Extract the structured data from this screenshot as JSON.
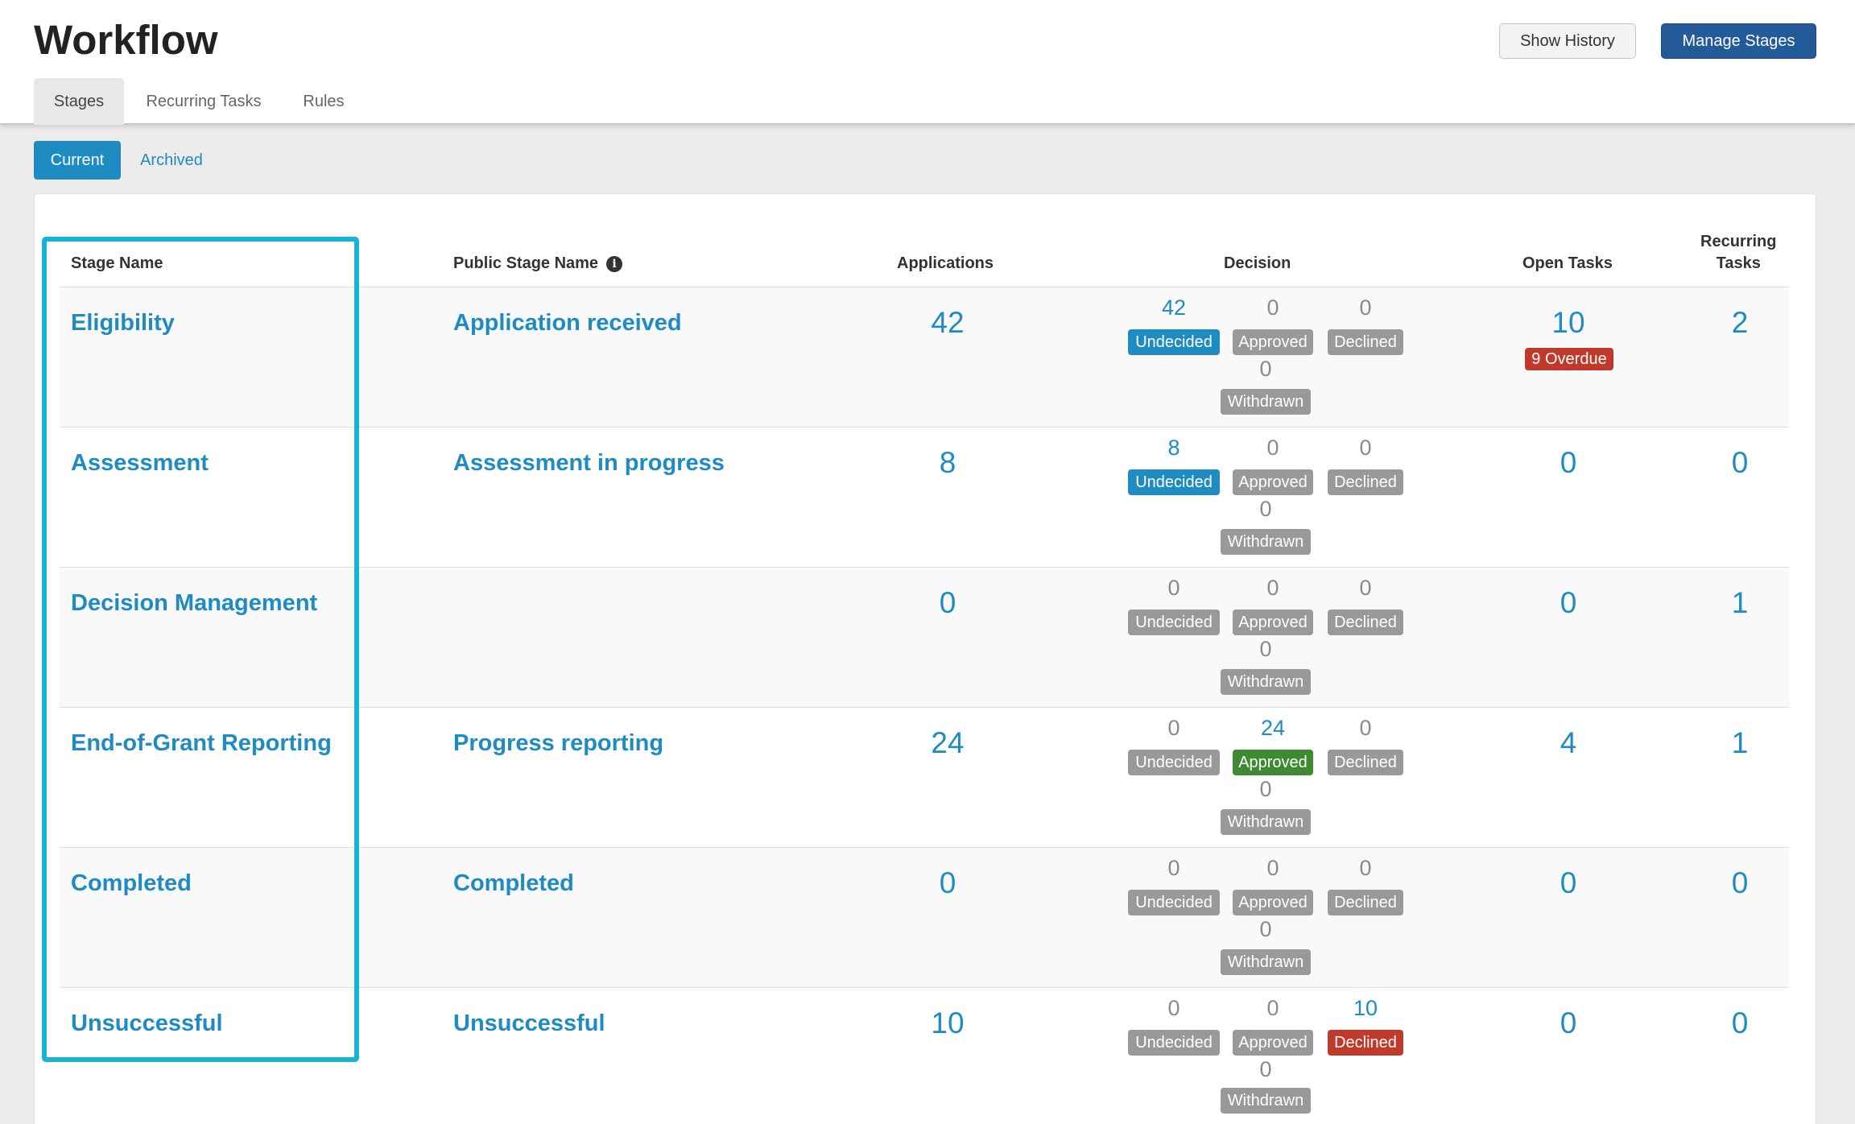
{
  "header": {
    "title": "Workflow",
    "show_history": "Show History",
    "manage_stages": "Manage Stages",
    "tabs": [
      "Stages",
      "Recurring Tasks",
      "Rules"
    ]
  },
  "filters": {
    "current": "Current",
    "archived": "Archived"
  },
  "table": {
    "columns": {
      "stage_name": "Stage Name",
      "public_stage_name": "Public Stage Name",
      "applications": "Applications",
      "decision": "Decision",
      "open_tasks": "Open Tasks",
      "recurring_line1": "Recurring",
      "recurring_line2": "Tasks"
    },
    "decision_labels": {
      "undecided": "Undecided",
      "approved": "Approved",
      "declined": "Declined",
      "withdrawn": "Withdrawn"
    },
    "rows": [
      {
        "stage": "Eligibility",
        "public": "Application received",
        "applications": "42",
        "undecided": "42",
        "approved": "0",
        "declined": "0",
        "withdrawn": "0",
        "open_tasks": "10",
        "overdue": "9 Overdue",
        "recurring": "2"
      },
      {
        "stage": "Assessment",
        "public": "Assessment in progress",
        "applications": "8",
        "undecided": "8",
        "approved": "0",
        "declined": "0",
        "withdrawn": "0",
        "open_tasks": "0",
        "recurring": "0"
      },
      {
        "stage": "Decision Management",
        "public": "",
        "applications": "0",
        "undecided": "0",
        "approved": "0",
        "declined": "0",
        "withdrawn": "0",
        "open_tasks": "0",
        "recurring": "1"
      },
      {
        "stage": "End-of-Grant Reporting",
        "public": "Progress reporting",
        "applications": "24",
        "undecided": "0",
        "approved": "24",
        "declined": "0",
        "withdrawn": "0",
        "open_tasks": "4",
        "recurring": "1"
      },
      {
        "stage": "Completed",
        "public": "Completed",
        "applications": "0",
        "undecided": "0",
        "approved": "0",
        "declined": "0",
        "withdrawn": "0",
        "open_tasks": "0",
        "recurring": "0"
      },
      {
        "stage": "Unsuccessful",
        "public": "Unsuccessful",
        "applications": "10",
        "undecided": "0",
        "approved": "0",
        "declined": "10",
        "withdrawn": "0",
        "open_tasks": "0",
        "recurring": "0"
      }
    ]
  },
  "colors": {
    "link": "#1e8bc3",
    "primary_button": "#235a9a",
    "approved": "#3e8a33",
    "declined_overdue": "#c0392b",
    "inactive_badge": "#999999",
    "highlight_border": "#17b3d6"
  }
}
